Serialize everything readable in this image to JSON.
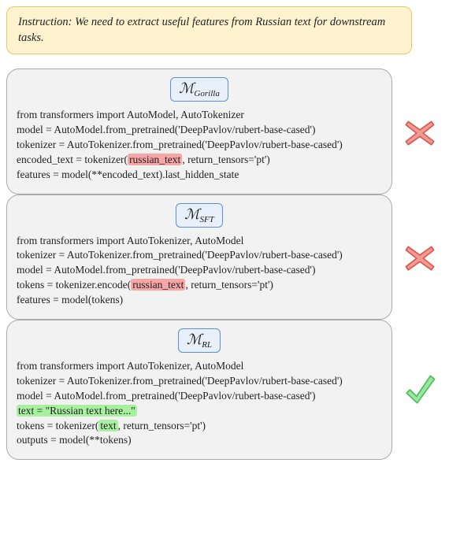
{
  "instruction": "Instruction: We need to extract useful features from Russian text for downstream tasks.",
  "cards": [
    {
      "model_sub": "Gorilla",
      "result": "x",
      "lines": [
        {
          "segments": [
            {
              "t": "from transformers import AutoModel, AutoTokenizer"
            }
          ]
        },
        {
          "segments": [
            {
              "t": "model = AutoModel.from_pretrained('DeepPavlov/rubert-base-cased')"
            }
          ]
        },
        {
          "segments": [
            {
              "t": "tokenizer = AutoTokenizer.from_pretrained('DeepPavlov/rubert-base-cased')"
            }
          ]
        },
        {
          "segments": [
            {
              "t": "encoded_text = tokenizer("
            },
            {
              "t": "russian_text",
              "hl": "red"
            },
            {
              "t": ", return_tensors='pt')"
            }
          ]
        },
        {
          "segments": [
            {
              "t": "features = model(**encoded_text).last_hidden_state"
            }
          ]
        }
      ]
    },
    {
      "model_sub": "SFT",
      "result": "x",
      "lines": [
        {
          "segments": [
            {
              "t": "from transformers import AutoTokenizer, AutoModel"
            }
          ]
        },
        {
          "segments": [
            {
              "t": "tokenizer = AutoTokenizer.from_pretrained('DeepPavlov/rubert-base-cased')"
            }
          ]
        },
        {
          "segments": [
            {
              "t": "model = AutoModel.from_pretrained('DeepPavlov/rubert-base-cased')"
            }
          ]
        },
        {
          "segments": [
            {
              "t": "tokens = tokenizer.encode("
            },
            {
              "t": "russian_text",
              "hl": "red"
            },
            {
              "t": ", return_tensors='pt')"
            }
          ]
        },
        {
          "segments": [
            {
              "t": "features = model(tokens)"
            }
          ]
        }
      ]
    },
    {
      "model_sub": "RL",
      "result": "check",
      "lines": [
        {
          "segments": [
            {
              "t": "from transformers import AutoTokenizer, AutoModel"
            }
          ]
        },
        {
          "segments": [
            {
              "t": "tokenizer = AutoTokenizer.from_pretrained('DeepPavlov/rubert-base-cased')"
            }
          ]
        },
        {
          "segments": [
            {
              "t": "model = AutoModel.from_pretrained('DeepPavlov/rubert-base-cased')"
            }
          ]
        },
        {
          "segments": [
            {
              "t": "text = \"Russian text here...\"",
              "hl": "green"
            }
          ]
        },
        {
          "segments": [
            {
              "t": "tokens = tokenizer("
            },
            {
              "t": "text",
              "hl": "green"
            },
            {
              "t": ", return_tensors='pt')"
            }
          ]
        },
        {
          "segments": [
            {
              "t": "outputs = model(**tokens)"
            }
          ]
        }
      ]
    }
  ],
  "icons": {
    "x_color_fill": "#f29b94",
    "x_color_stroke": "#d9574e",
    "check_color_fill": "#9be6a0",
    "check_color_stroke": "#4bbf58"
  }
}
